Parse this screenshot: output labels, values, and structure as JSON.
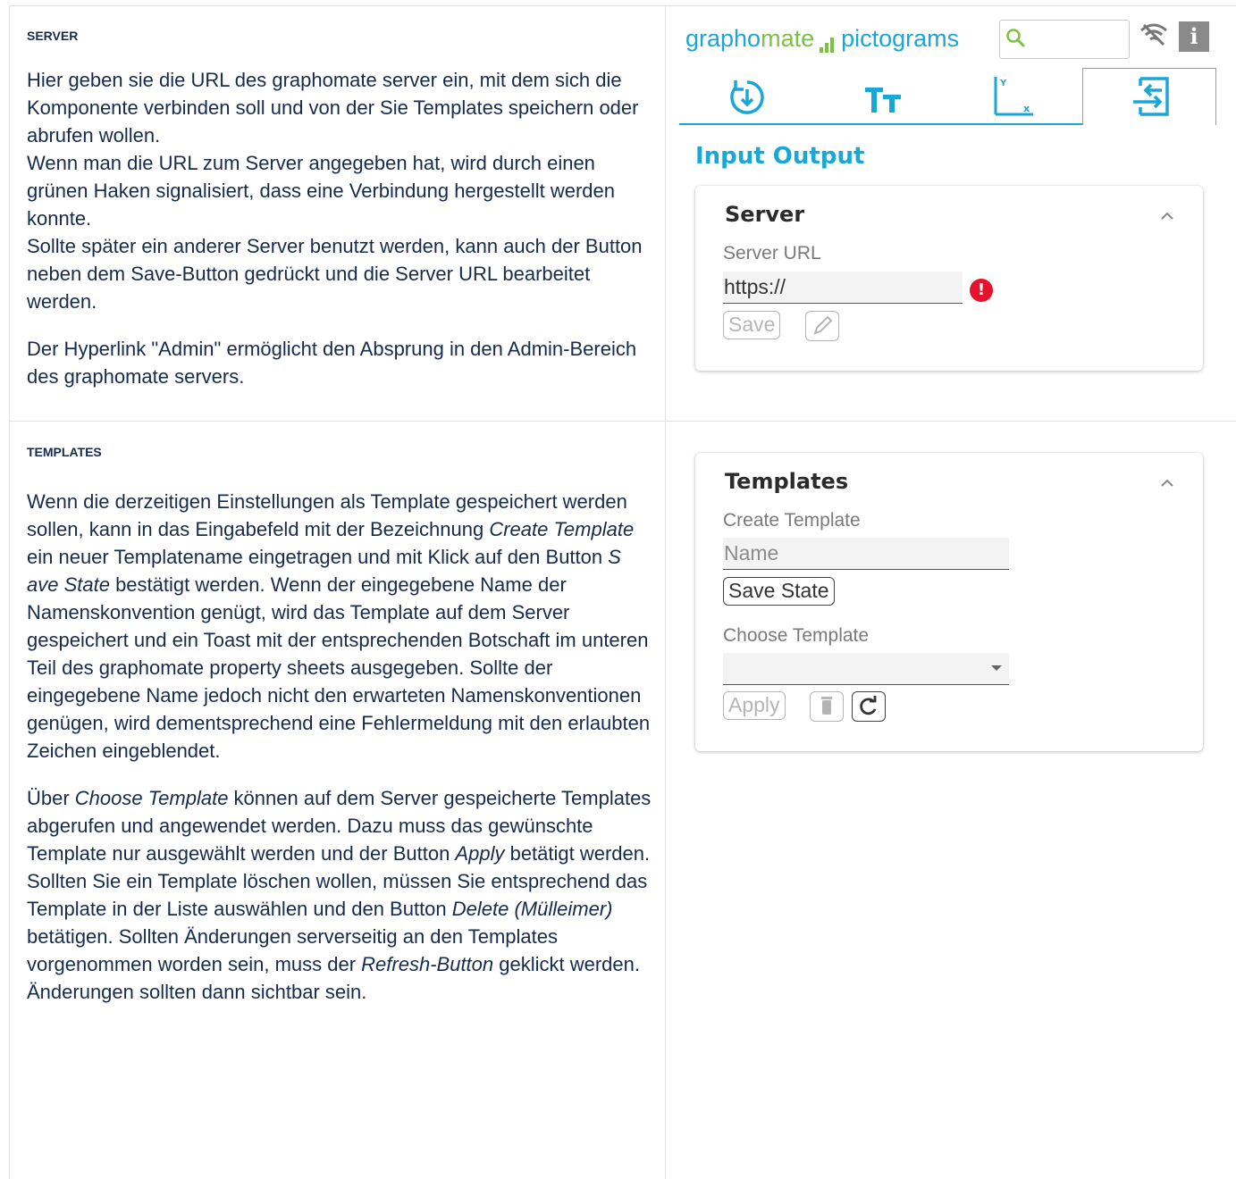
{
  "server_section": {
    "heading": "SERVER",
    "paragraphs": [
      "Hier geben sie die URL des graphomate server ein, mit dem sich die Komponente verbinden soll und von der Sie Templates speichern oder abrufen wollen.",
      "Wenn man die URL zum Server angegeben hat, wird durch einen grünen Haken signalisiert, dass eine Verbindung hergestellt werden konnte.",
      "Sollte später ein anderer Server benutzt werden, kann auch der Button neben dem Save-Button gedrückt und die Server URL bearbeitet werden."
    ],
    "admin_paragraph": "Der Hyperlink \"Admin\" ermöglicht den Absprung in den Admin-Bereich des graphomate servers."
  },
  "templates_section": {
    "heading": "TEMPLATES",
    "p1": {
      "a": "Wenn die derzeitigen Einstellungen als Template gespeichert werden sollen, kann in das Eingabefeld mit der Bezeichnung ",
      "a_em": "Create Template",
      "b": " ein neuer Templatename eingetragen und mit Klick auf den Button ",
      "b_em": "S ave State",
      "c": " bestätigt werden. Wenn der eingegebene Name der Namenskonvention genügt, wird das Template auf dem Server gespeichert und ein Toast mit der entsprechenden Botschaft im unteren Teil des graphomate property sheets ausgegeben. Sollte der eingegebene Name jedoch nicht den erwarteten Namenskonventionen genügen, wird dementsprechend eine Fehlermeldung mit den erlaubten Zeichen eingeblendet."
    },
    "p2": {
      "a": "Über ",
      "a_em": "Choose Template",
      "b": " können auf dem Server gespeicherte Templates abgerufen und angewendet werden. Dazu muss das gewünschte Template nur ausgewählt werden und der Button ",
      "b_em": "Apply",
      "c": " betätigt werden. Sollten Sie ein Template löschen wollen, müssen Sie entsprechend das Template in der Liste auswählen und den Button ",
      "c_em": "Delete (Mülleimer)",
      "d": " betätigen. Sollten Änderungen serverseitig an den Templates vorgenommen worden sein, muss der ",
      "d_em": "Refresh-Button",
      "e": " geklickt werden. Änderungen sollten dann sichtbar sein."
    }
  },
  "panel": {
    "brand_part1": "grapho",
    "brand_part2": "mate",
    "brand_part3": "pictograms",
    "search_placeholder": "",
    "section_title": "Input Output",
    "server_card": {
      "title": "Server",
      "url_label": "Server URL",
      "url_value": "https://",
      "save_label": "Save"
    },
    "templates_card": {
      "title": "Templates",
      "create_label": "Create Template",
      "name_placeholder": "Name",
      "save_state_label": "Save State",
      "choose_label": "Choose Template",
      "apply_label": "Apply"
    },
    "colors": {
      "accent": "#1aa6d6",
      "brand_green": "#7dc243",
      "error": "#e4122b"
    }
  }
}
